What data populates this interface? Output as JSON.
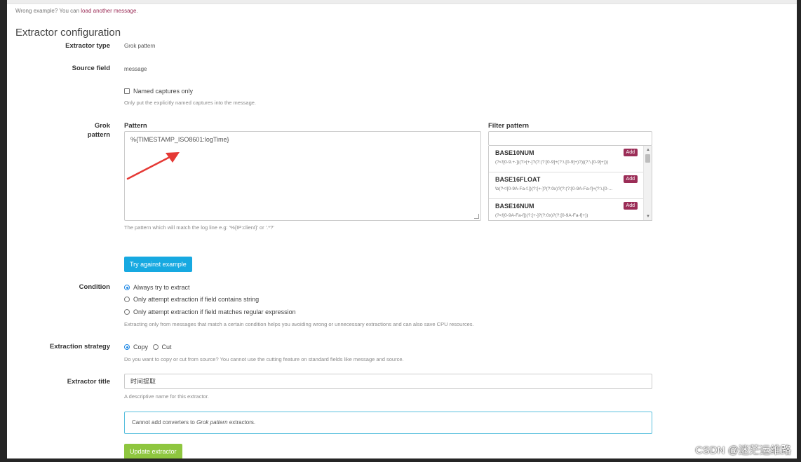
{
  "header": {
    "wrong_example_text": "Wrong example? You can",
    "load_another_link": "load another message",
    "wrong_example_suffix": "."
  },
  "section_title": "Extractor configuration",
  "extractor_type": {
    "label": "Extractor type",
    "value": "Grok pattern"
  },
  "source_field": {
    "label": "Source field",
    "value": "message"
  },
  "named_captures": {
    "label": "Named captures only",
    "checked": false,
    "help": "Only put the explicitly named captures into the message."
  },
  "grok": {
    "label_line1": "Grok",
    "label_line2": "pattern",
    "pattern_heading": "Pattern",
    "pattern_value": "%{TIMESTAMP_ISO8601:logTime}",
    "pattern_help": "The pattern which will match the log line e.g: '%{IP:client}' or '.*?'",
    "filter_heading": "Filter pattern",
    "filter_value": "",
    "add_label": "Add",
    "patterns": [
      {
        "name": "BASE10NUM",
        "regex": "(?<![0-9.+-])(?>[+-]?(?:(?:[0-9]+(?:\\.[0-9]+)?)|(?:\\.[0-9]+)))"
      },
      {
        "name": "BASE16FLOAT",
        "regex": "\\b(?<![0-9A-Fa-f.])(?:[+-]?(?:0x)?(?:(?:[0-9A-Fa-f]+(?:\\.[0-..."
      },
      {
        "name": "BASE16NUM",
        "regex": "(?<![0-9A-Fa-f])(?:[+-]?(?:0x)?(?:[0-9A-Fa-f]+))"
      }
    ]
  },
  "try_button": "Try against example",
  "condition": {
    "label": "Condition",
    "options": [
      "Always try to extract",
      "Only attempt extraction if field contains string",
      "Only attempt extraction if field matches regular expression"
    ],
    "selected": 0,
    "help": "Extracting only from messages that match a certain condition helps you avoiding wrong or unnecessary extractions and can also save CPU resources."
  },
  "strategy": {
    "label": "Extraction strategy",
    "options": [
      "Copy",
      "Cut"
    ],
    "selected": 0,
    "help": "Do you want to copy or cut from source? You cannot use the cutting feature on standard fields like message and source."
  },
  "extractor_title": {
    "label": "Extractor title",
    "value": "时间提取",
    "help": "A descriptive name for this extractor."
  },
  "converters_alert": {
    "prefix": "Cannot add converters to",
    "emph": "Grok pattern",
    "suffix": "extractors."
  },
  "update_button": "Update extractor",
  "watermark": "CSDN @迷茫运维路",
  "colors": {
    "accent_blue": "#17a9e1",
    "add_purple": "#9b2d57",
    "update_green": "#8ec63f",
    "arrow_red": "#e53935"
  }
}
